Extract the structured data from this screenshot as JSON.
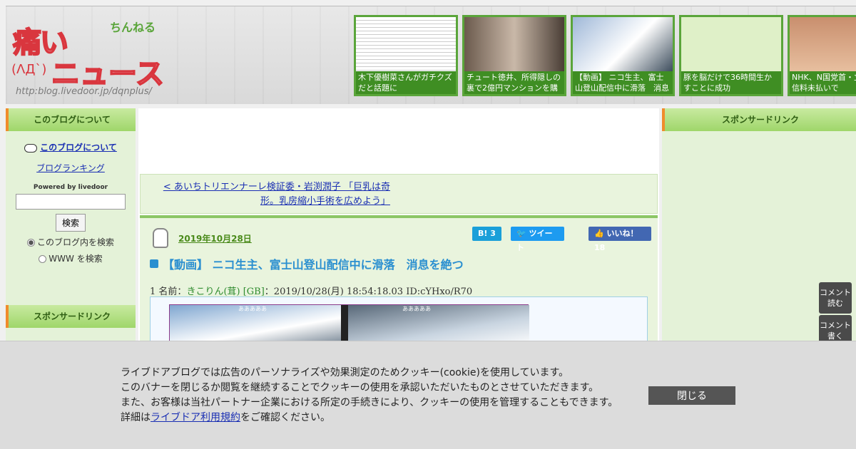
{
  "header": {
    "logo": {
      "main_text": "痛い",
      "sub_text": "ちんねる",
      "face_text": "(ΛД`)",
      "news_text": "ニュース",
      "url": "http:blog.livedoor.jp/dqnplus/"
    },
    "thumbnails": [
      {
        "caption": "木下優樹菜さんがガチクズだと話題に"
      },
      {
        "caption": "チュート徳井、所得隠しの裏で2億円マンションを購"
      },
      {
        "caption": "【動画】 ニコ生主、富士山登山配信中に滑落　消息を"
      },
      {
        "caption": "豚を脳だけで36時間生かすことに成功"
      },
      {
        "caption": "NHK、N国党首・立氏を受信料未払いで"
      }
    ]
  },
  "left_sidebar": {
    "about_heading": "このブログについて",
    "about_link": "このブログについて",
    "ranking_link": "ブログランキング",
    "powered_by": "Powered by livedoor",
    "search_button": "検索",
    "search_in_blog": "このブログ内を検索",
    "search_www": "WWW を検索",
    "sponsor_heading": "スポンサードリンク"
  },
  "right_sidebar": {
    "sponsor_heading": "スポンサードリンク"
  },
  "main": {
    "prev_link": "< あいちトリエンナーレ検証委・岩渕潤子 「巨乳は奇形。乳房縮小手術を広めよう」",
    "date": "2019年10月28日",
    "share": {
      "hatena_label": "B!",
      "hatena_count": "3",
      "tweet_label": "ツイート",
      "like_label": "いいね！",
      "like_count": "18"
    },
    "title": "【動画】 ニコ生主、富士山登山配信中に滑落　消息を絶つ",
    "post": {
      "number": "1",
      "name_label": "名前：",
      "name": "きこりん(茸) [GB]",
      "meta": "：2019/10/28(月) 18:54:18.03 ID:cYHxo/R70",
      "video_caption_1": "あああああ",
      "video_caption_2": "あああああ"
    }
  },
  "floating": {
    "read_comments": "コメント読む",
    "write_comments": "コメント書く"
  },
  "cookie_banner": {
    "line1": "ライブドアブログでは広告のパーソナライズや効果測定のためクッキー(cookie)を使用しています。",
    "line2": "このバナーを閉じるか閲覧を継続することでクッキーの使用を承認いただいたものとさせていただきます。",
    "line3": "また、お客様は当社パートナー企業における所定の手続きにより、クッキーの使用を管理することもできます。",
    "line4_prefix": "詳細は",
    "line4_link": "ライブドア利用規約",
    "line4_suffix": "をご確認ください。",
    "close_button": "閉じる"
  }
}
